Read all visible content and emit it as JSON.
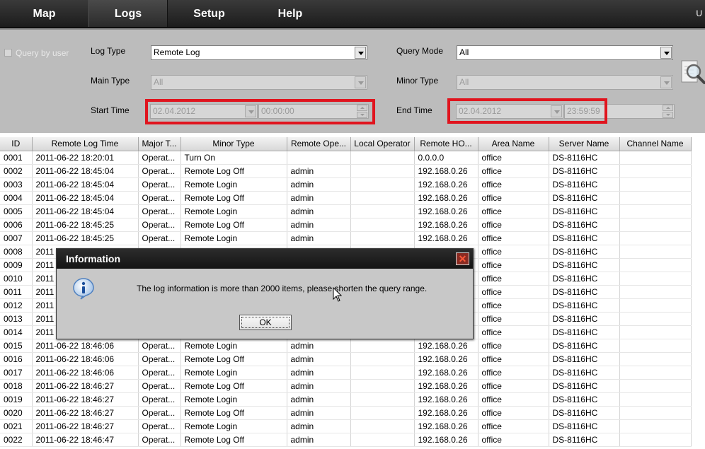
{
  "nav": {
    "tabs": [
      {
        "label": "Map",
        "active": false
      },
      {
        "label": "Logs",
        "active": true
      },
      {
        "label": "Setup",
        "active": false
      },
      {
        "label": "Help",
        "active": false
      }
    ],
    "user_fragment": "U"
  },
  "query": {
    "query_by_user_label": "Query by user",
    "log_type_label": "Log Type",
    "log_type_value": "Remote Log",
    "query_mode_label": "Query Mode",
    "query_mode_value": "All",
    "main_type_label": "Main Type",
    "main_type_value": "All",
    "minor_type_label": "Minor Type",
    "minor_type_value": "All",
    "start_time_label": "Start Time",
    "start_date": "02.04.2012",
    "start_time": "00:00:00",
    "end_time_label": "End Time",
    "end_date": "02.04.2012",
    "end_time": "23:59:59",
    "highlight_color": "#e0141e"
  },
  "table": {
    "columns": [
      "ID",
      "Remote Log Time",
      "Major T...",
      "Minor Type",
      "Remote Ope...",
      "Local Operator",
      "Remote HO...",
      "Area Name",
      "Server Name",
      "Channel Name"
    ],
    "rows": [
      [
        "0001",
        "2011-06-22 18:20:01",
        "Operat...",
        "Turn On",
        "",
        "",
        "0.0.0.0",
        "office",
        "DS-8116HC",
        ""
      ],
      [
        "0002",
        "2011-06-22 18:45:04",
        "Operat...",
        "Remote Log Off",
        "admin",
        "",
        "192.168.0.26",
        "office",
        "DS-8116HC",
        ""
      ],
      [
        "0003",
        "2011-06-22 18:45:04",
        "Operat...",
        "Remote Login",
        "admin",
        "",
        "192.168.0.26",
        "office",
        "DS-8116HC",
        ""
      ],
      [
        "0004",
        "2011-06-22 18:45:04",
        "Operat...",
        "Remote Log Off",
        "admin",
        "",
        "192.168.0.26",
        "office",
        "DS-8116HC",
        ""
      ],
      [
        "0005",
        "2011-06-22 18:45:04",
        "Operat...",
        "Remote Login",
        "admin",
        "",
        "192.168.0.26",
        "office",
        "DS-8116HC",
        ""
      ],
      [
        "0006",
        "2011-06-22 18:45:25",
        "Operat...",
        "Remote Log Off",
        "admin",
        "",
        "192.168.0.26",
        "office",
        "DS-8116HC",
        ""
      ],
      [
        "0007",
        "2011-06-22 18:45:25",
        "Operat...",
        "Remote Login",
        "admin",
        "",
        "192.168.0.26",
        "office",
        "DS-8116HC",
        ""
      ],
      [
        "0008",
        "2011",
        "",
        "",
        "",
        "",
        "",
        "office",
        "DS-8116HC",
        ""
      ],
      [
        "0009",
        "2011",
        "",
        "",
        "",
        "",
        "",
        "office",
        "DS-8116HC",
        ""
      ],
      [
        "0010",
        "2011",
        "",
        "",
        "",
        "",
        "",
        "office",
        "DS-8116HC",
        ""
      ],
      [
        "0011",
        "2011",
        "",
        "",
        "",
        "",
        "",
        "office",
        "DS-8116HC",
        ""
      ],
      [
        "0012",
        "2011",
        "",
        "",
        "",
        "",
        "",
        "office",
        "DS-8116HC",
        ""
      ],
      [
        "0013",
        "2011",
        "",
        "",
        "",
        "",
        "",
        "office",
        "DS-8116HC",
        ""
      ],
      [
        "0014",
        "2011",
        "",
        "",
        "",
        "",
        "",
        "office",
        "DS-8116HC",
        ""
      ],
      [
        "0015",
        "2011-06-22 18:46:06",
        "Operat...",
        "Remote Login",
        "admin",
        "",
        "192.168.0.26",
        "office",
        "DS-8116HC",
        ""
      ],
      [
        "0016",
        "2011-06-22 18:46:06",
        "Operat...",
        "Remote Log Off",
        "admin",
        "",
        "192.168.0.26",
        "office",
        "DS-8116HC",
        ""
      ],
      [
        "0017",
        "2011-06-22 18:46:06",
        "Operat...",
        "Remote Login",
        "admin",
        "",
        "192.168.0.26",
        "office",
        "DS-8116HC",
        ""
      ],
      [
        "0018",
        "2011-06-22 18:46:27",
        "Operat...",
        "Remote Log Off",
        "admin",
        "",
        "192.168.0.26",
        "office",
        "DS-8116HC",
        ""
      ],
      [
        "0019",
        "2011-06-22 18:46:27",
        "Operat...",
        "Remote Login",
        "admin",
        "",
        "192.168.0.26",
        "office",
        "DS-8116HC",
        ""
      ],
      [
        "0020",
        "2011-06-22 18:46:27",
        "Operat...",
        "Remote Log Off",
        "admin",
        "",
        "192.168.0.26",
        "office",
        "DS-8116HC",
        ""
      ],
      [
        "0021",
        "2011-06-22 18:46:27",
        "Operat...",
        "Remote Login",
        "admin",
        "",
        "192.168.0.26",
        "office",
        "DS-8116HC",
        ""
      ],
      [
        "0022",
        "2011-06-22 18:46:47",
        "Operat...",
        "Remote Log Off",
        "admin",
        "",
        "192.168.0.26",
        "office",
        "DS-8116HC",
        ""
      ]
    ]
  },
  "dialog": {
    "title": "Information",
    "close_glyph": "✕",
    "message": "The log information is more than 2000 items, please shorten the query range.",
    "ok_label": "OK",
    "icon": "info-icon"
  }
}
